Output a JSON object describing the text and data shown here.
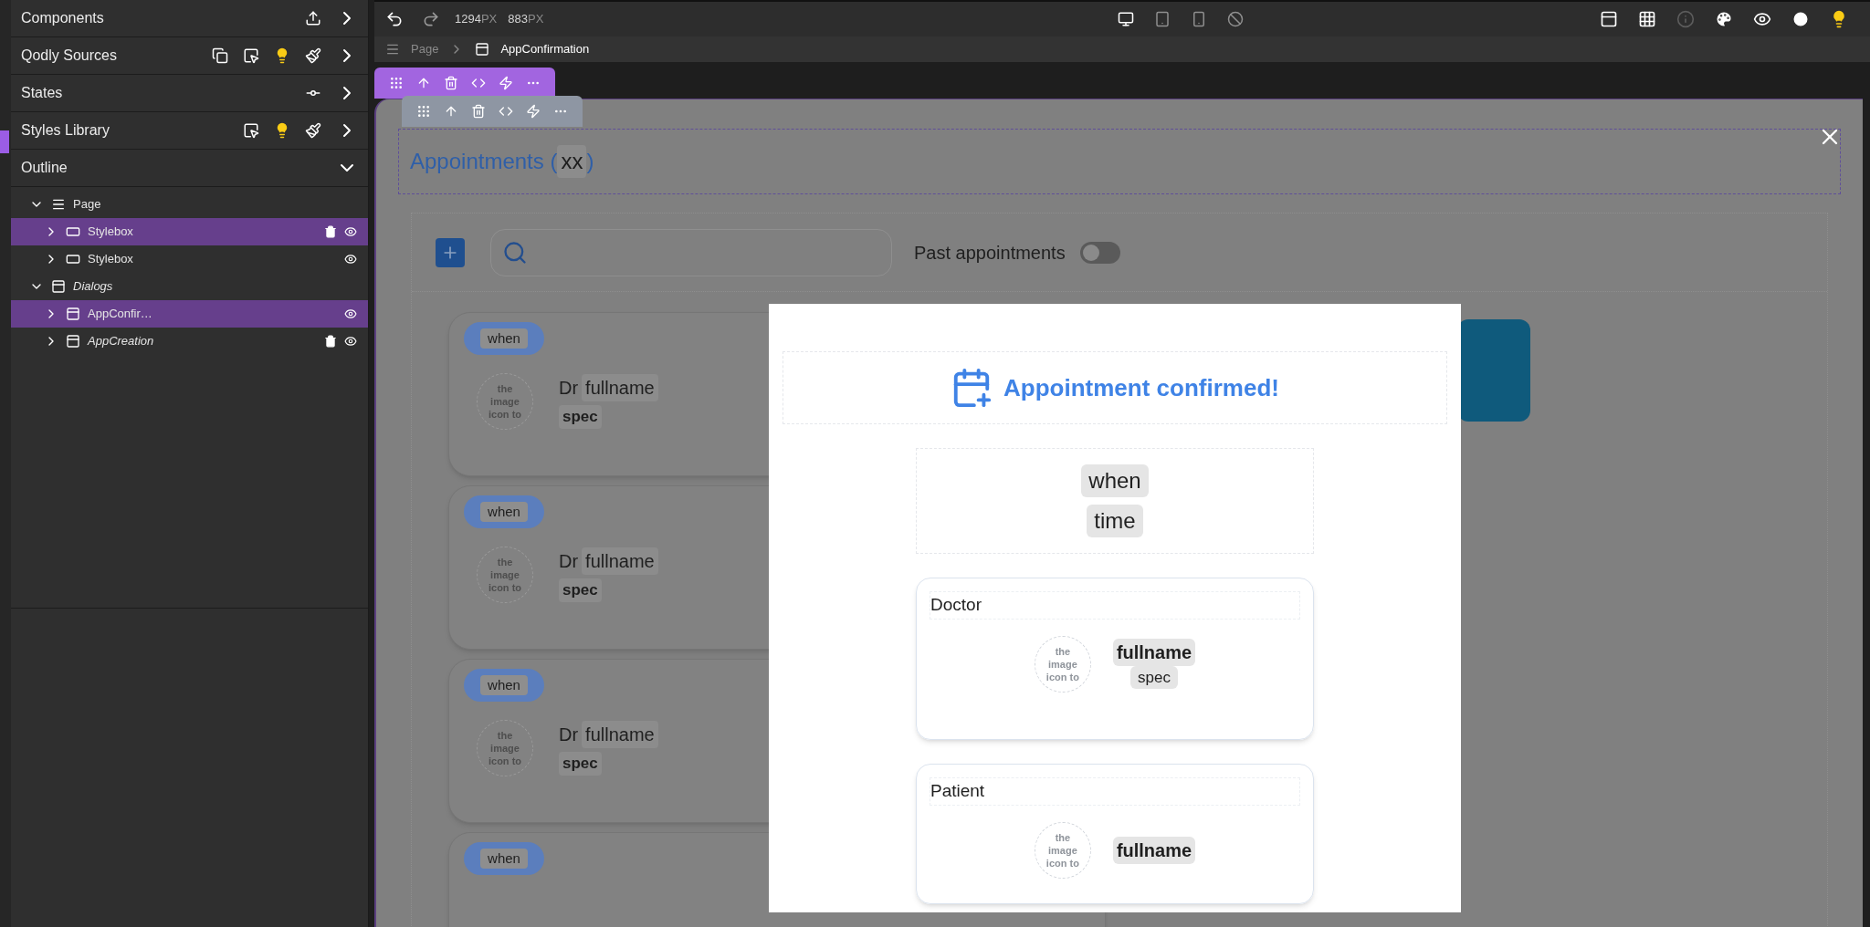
{
  "sidebar": {
    "sections": [
      {
        "label": "Components",
        "expanded": false
      },
      {
        "label": "Qodly Sources",
        "expanded": false
      },
      {
        "label": "States",
        "expanded": false
      },
      {
        "label": "Styles Library",
        "expanded": false
      },
      {
        "label": "Outline",
        "expanded": true
      }
    ],
    "outline": [
      {
        "label": "Page",
        "kind": "page",
        "expanded": true,
        "selected": false,
        "italic": false,
        "deletable": false,
        "children": [
          {
            "label": "Stylebox",
            "kind": "stylebox",
            "expanded": false,
            "selected": true,
            "italic": false,
            "deletable": true
          },
          {
            "label": "Stylebox",
            "kind": "stylebox",
            "expanded": false,
            "selected": false,
            "italic": false,
            "deletable": false
          }
        ]
      },
      {
        "label": "Dialogs",
        "kind": "dialog",
        "expanded": true,
        "selected": false,
        "italic": true,
        "deletable": false,
        "children": [
          {
            "label": "AppConfir…",
            "kind": "dialog",
            "expanded": false,
            "selected": true,
            "italic": false,
            "deletable": false
          },
          {
            "label": "AppCreation",
            "kind": "dialog",
            "expanded": false,
            "selected": false,
            "italic": true,
            "deletable": true
          }
        ]
      }
    ]
  },
  "toolbar": {
    "width": {
      "value": "1294",
      "unit": "PX"
    },
    "height": {
      "value": "883",
      "unit": "PX"
    },
    "devices": [
      {
        "kind": "desktop",
        "selected": true
      },
      {
        "kind": "tablet",
        "selected": false
      },
      {
        "kind": "mobile",
        "selected": false
      },
      {
        "kind": "none",
        "selected": false
      }
    ]
  },
  "breadcrumb": [
    {
      "label": "Page",
      "kind": "page"
    },
    {
      "label": "AppConfirmation",
      "kind": "dialog"
    }
  ],
  "canvas": {
    "title": {
      "prefix": "Appointments (",
      "count": "xx",
      "suffix": ")"
    },
    "filter": {
      "label": "Past appointments",
      "on": false
    },
    "appointments": [
      {
        "when": "when",
        "doctor_prefix": "Dr",
        "fullname": "fullname",
        "spec": "spec",
        "image_alt": "the image icon to"
      },
      {
        "when": "when",
        "doctor_prefix": "Dr",
        "fullname": "fullname",
        "spec": "spec",
        "image_alt": "the image icon to"
      },
      {
        "when": "when",
        "doctor_prefix": "Dr",
        "fullname": "fullname",
        "spec": "spec",
        "image_alt": "the image icon to"
      },
      {
        "when": "when"
      }
    ]
  },
  "dialog": {
    "title": "Appointment confirmed!",
    "when": "when",
    "time": "time",
    "doctor": {
      "heading": "Doctor",
      "fullname": "fullname",
      "spec": "spec",
      "image_alt": "the image icon to"
    },
    "patient": {
      "heading": "Patient",
      "fullname": "fullname",
      "image_alt": "the image icon to"
    }
  }
}
